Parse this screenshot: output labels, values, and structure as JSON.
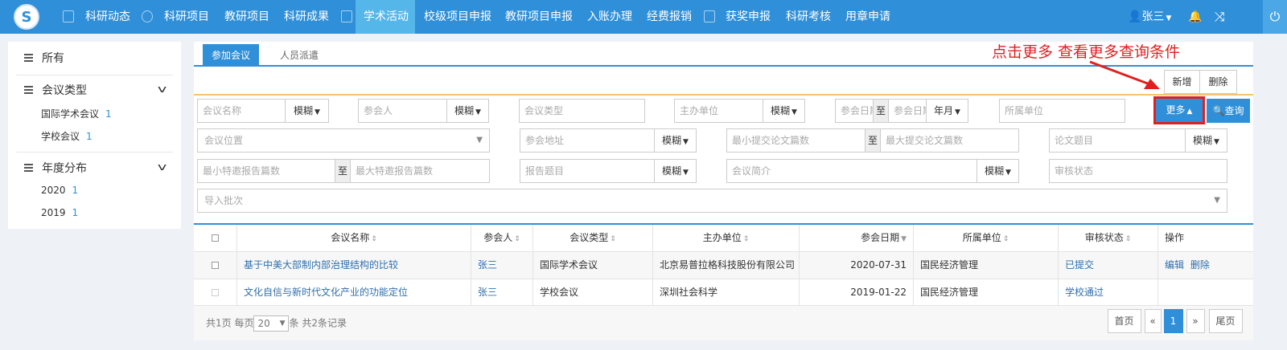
{
  "nav": {
    "items": [
      "科研动态",
      "科研项目",
      "教研项目",
      "科研成果",
      "学术活动",
      "校级项目申报",
      "教研项目申报",
      "入账办理",
      "经费报销",
      "获奖申报",
      "科研考核",
      "用章申请"
    ],
    "active": "学术活动",
    "user": "张三",
    "brand_color": "#2f8fd8"
  },
  "sidebar": {
    "all": "所有",
    "group1": {
      "title": "会议类型",
      "items": [
        {
          "label": "国际学术会议",
          "count": "1"
        },
        {
          "label": "学校会议",
          "count": "1"
        }
      ]
    },
    "group2": {
      "title": "年度分布",
      "items": [
        {
          "label": "2020",
          "count": "1"
        },
        {
          "label": "2019",
          "count": "1"
        }
      ]
    }
  },
  "tabs": [
    "参加会议",
    "人员派遣"
  ],
  "toolbar": {
    "add": "新增",
    "delete": "删除",
    "more": "更多",
    "query": "查询"
  },
  "filters": {
    "meeting_name": "会议名称",
    "fuzzy": "模糊",
    "participant": "参会人",
    "meeting_type": "会议类型",
    "organizer": "主办单位",
    "date_from": "参会日期",
    "zhi": "至",
    "date_to": "参会日期",
    "year_month": "年月",
    "unit": "所属单位",
    "location": "会议位置",
    "address": "参会地址",
    "min_papers": "最小提交论文篇数",
    "max_papers": "最大提交论文篇数",
    "paper_title": "论文题目",
    "min_invited": "最小特邀报告篇数",
    "max_invited": "最大特邀报告篇数",
    "report_title": "报告题目",
    "intro": "会议简介",
    "review_status": "审核状态",
    "batch": "导入批次"
  },
  "table": {
    "headers": [
      "会议名称",
      "参会人",
      "会议类型",
      "主办单位",
      "参会日期",
      "所属单位",
      "审核状态",
      "操作"
    ],
    "rows": [
      {
        "name": "基于中美大部制内部治理结构的比较",
        "person": "张三",
        "type": "国际学术会议",
        "org": "北京易普拉格科技股份有限公司",
        "date": "2020-07-31",
        "unit": "国民经济管理",
        "status": "已提交",
        "edit": "编辑",
        "del": "删除"
      },
      {
        "name": "文化自信与新时代文化产业的功能定位",
        "person": "张三",
        "type": "学校会议",
        "org": "深圳社会科学",
        "date": "2019-01-22",
        "unit": "国民经济管理",
        "status": "学校通过",
        "edit": "",
        "del": ""
      }
    ]
  },
  "pagination": {
    "total_pages": "共1页",
    "per_page_label": "每页",
    "per_page": "20",
    "unit": "条",
    "total_records": "共2条记录",
    "first": "首页",
    "prev": "«",
    "current": "1",
    "next": "»",
    "last": "尾页"
  },
  "annotation": "点击更多 查看更多查询条件"
}
